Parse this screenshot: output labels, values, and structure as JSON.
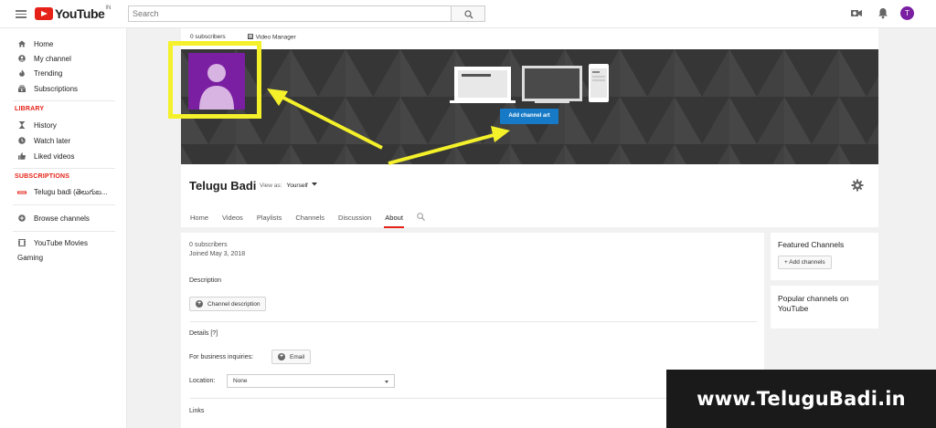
{
  "topbar": {
    "logo_text": "YouTube",
    "logo_region": "IN",
    "search_placeholder": "Search",
    "avatar_letter": "T"
  },
  "sidebar": {
    "items": [
      {
        "label": "Home",
        "icon": "home-icon"
      },
      {
        "label": "My channel",
        "icon": "person-icon"
      },
      {
        "label": "Trending",
        "icon": "flame-icon"
      },
      {
        "label": "Subscriptions",
        "icon": "subscriptions-icon"
      }
    ],
    "library_heading": "LIBRARY",
    "library_items": [
      {
        "label": "History",
        "icon": "hourglass-icon"
      },
      {
        "label": "Watch later",
        "icon": "clock-icon"
      },
      {
        "label": "Liked videos",
        "icon": "thumbs-up-icon"
      }
    ],
    "subscriptions_heading": "SUBSCRIPTIONS",
    "subscription_items": [
      {
        "label": "Telugu badi (తెలుగుబ...",
        "icon": "channel-thumb-icon"
      }
    ],
    "browse_channels": "Browse channels",
    "youtube_movies": "YouTube Movies",
    "gaming": "Gaming"
  },
  "channel": {
    "subscribers_link": "0 subscribers",
    "video_manager_link": "Video Manager",
    "add_channel_art": "Add channel art",
    "name": "Telugu Badi",
    "view_as_label": "View as:",
    "view_as_value": "Yourself",
    "tabs": [
      "Home",
      "Videos",
      "Playlists",
      "Channels",
      "Discussion",
      "About"
    ],
    "active_tab": "About"
  },
  "about": {
    "subscribers": "0 subscribers",
    "joined": "Joined May 3, 2018",
    "description_heading": "Description",
    "channel_description_button": "Channel description",
    "details_heading": "Details [?]",
    "business_label": "For business inquiries:",
    "email_button": "Email",
    "location_label": "Location:",
    "location_value": "None",
    "links_heading": "Links"
  },
  "right": {
    "featured_title": "Featured Channels",
    "add_channels_button": "+ Add channels",
    "popular_title": "Popular channels on YouTube"
  },
  "watermark": "www.TeluguBadi.in",
  "colors": {
    "brand_red": "#e62117",
    "blue_button": "#167ac6",
    "highlight_yellow": "#f4f12b",
    "avatar_purple": "#7b1fa2"
  }
}
